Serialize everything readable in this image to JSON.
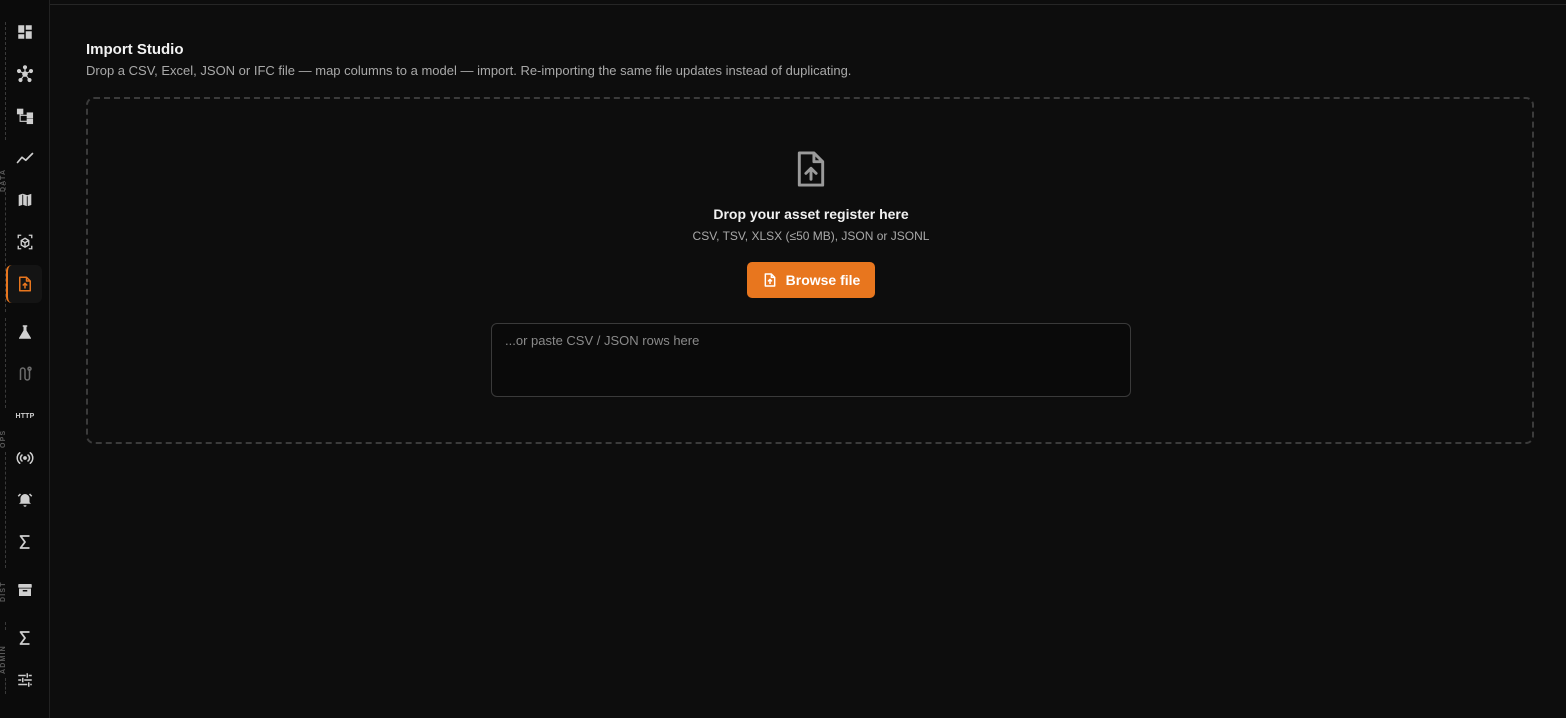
{
  "header": {
    "title": "Import Studio",
    "subtitle": "Drop a CSV, Excel, JSON or IFC file — map columns to a model — import. Re-importing the same file updates instead of duplicating."
  },
  "sidebar": {
    "groups": [
      "DATA",
      "OPS",
      "DIST",
      "ADMIN"
    ],
    "http_label": "HTTP",
    "items": [
      {
        "icon": "dashboard-icon"
      },
      {
        "icon": "network-icon"
      },
      {
        "icon": "hierarchy-icon"
      },
      {
        "icon": "trend-line-icon"
      },
      {
        "icon": "map-icon"
      },
      {
        "icon": "3d-box-icon"
      },
      {
        "icon": "file-upload-icon",
        "active": true
      },
      {
        "icon": "flask-icon"
      },
      {
        "icon": "route-icon"
      },
      {
        "icon": "http-icon"
      },
      {
        "icon": "broadcast-icon"
      },
      {
        "icon": "alarm-icon"
      },
      {
        "icon": "sigma-icon"
      },
      {
        "icon": "archive-icon"
      },
      {
        "icon": "sigma-icon"
      },
      {
        "icon": "sliders-icon"
      }
    ]
  },
  "dropzone": {
    "title": "Drop your asset register here",
    "hint": "CSV, TSV, XLSX (≤50 MB), JSON or JSONL",
    "browse_label": "Browse file",
    "paste_placeholder": "...or paste CSV / JSON rows here"
  },
  "colors": {
    "accent": "#e8761e",
    "background": "#0d0d0d"
  }
}
